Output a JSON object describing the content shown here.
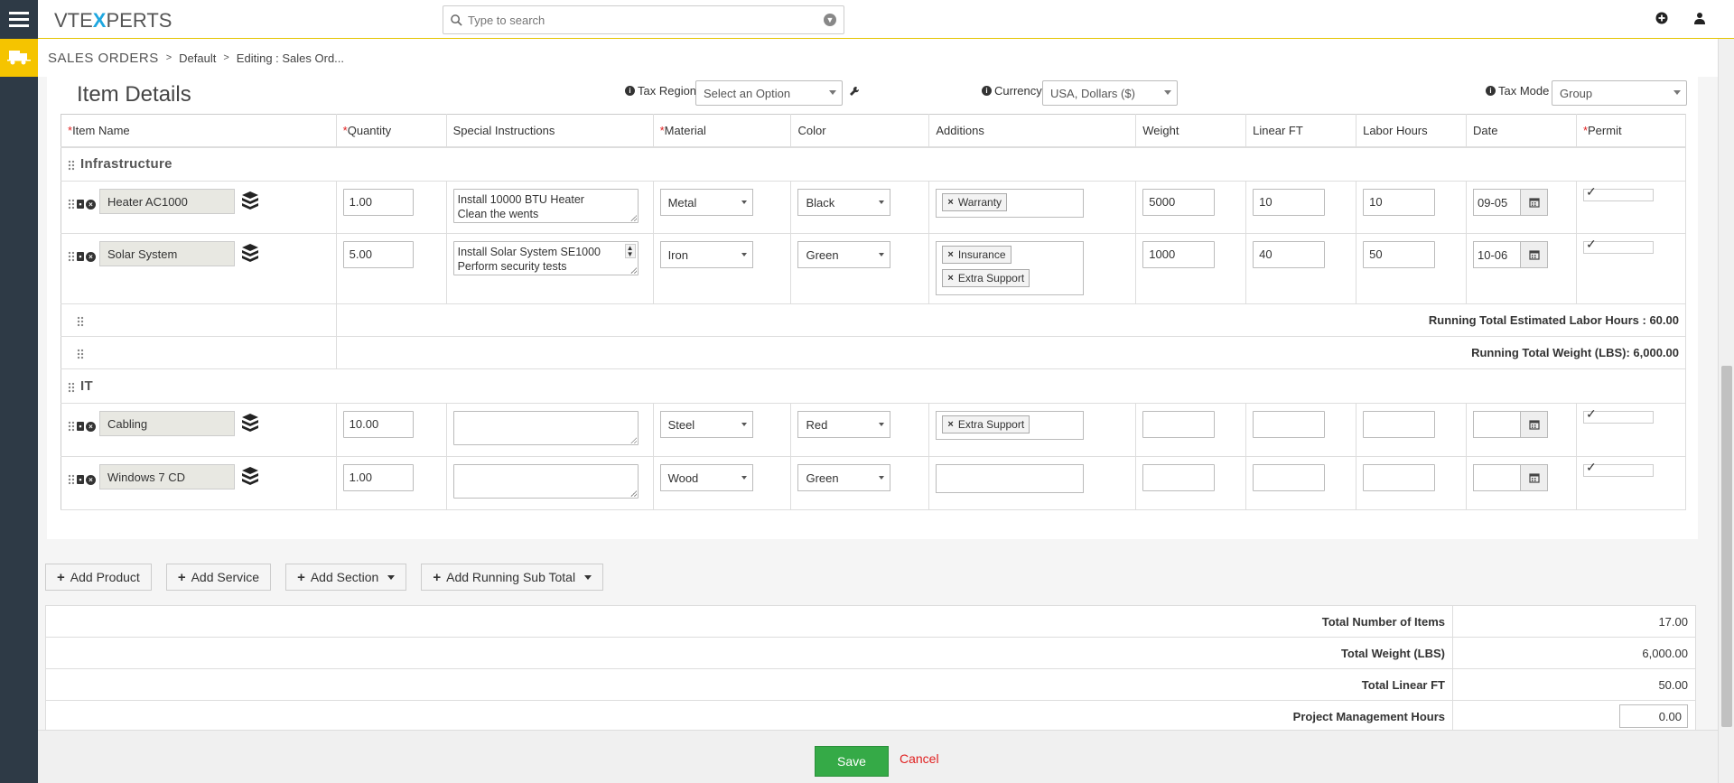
{
  "app": {
    "logo_left": "VTE",
    "logo_x": "X",
    "logo_right": "PERTS"
  },
  "search": {
    "placeholder": "Type to search"
  },
  "breadcrumb": {
    "module": "Sales Orders",
    "items": [
      "Default",
      "Editing : Sales Ord..."
    ]
  },
  "item_details": {
    "title": "Item Details",
    "tax_region_label": "Tax Region",
    "tax_region_value": "Select an Option",
    "currency_label": "Currency",
    "currency_value": "USA, Dollars ($)",
    "tax_mode_label": "Tax Mode",
    "tax_mode_value": "Group"
  },
  "columns": {
    "item_name": "Item Name",
    "quantity": "Quantity",
    "special_instructions": "Special Instructions",
    "material": "Material",
    "color": "Color",
    "additions": "Additions",
    "weight": "Weight",
    "linear_ft": "Linear FT",
    "labor_hours": "Labor Hours",
    "date": "Date",
    "permit": "Permit"
  },
  "sections": [
    {
      "name": "Infrastructure",
      "rows": [
        {
          "name": "Heater AC1000",
          "qty": "1.00",
          "instructions": "Install 10000 BTU Heater\nClean the wents",
          "material": "Metal",
          "color": "Black",
          "additions": [
            "Warranty"
          ],
          "weight": "5000",
          "linear_ft": "10",
          "labor": "10",
          "date": "09-05"
        },
        {
          "name": "Solar System",
          "qty": "5.00",
          "instructions": "Install Solar System SE1000\nPerform security tests",
          "material": "Iron",
          "color": "Green",
          "additions": [
            "Insurance",
            "Extra Support"
          ],
          "weight": "1000",
          "linear_ft": "40",
          "labor": "50",
          "date": "10-06"
        }
      ],
      "running_totals": [
        "Running Total Estimated Labor Hours : 60.00",
        "Running Total Weight (LBS): 6,000.00"
      ]
    },
    {
      "name": "IT",
      "rows": [
        {
          "name": "Cabling",
          "qty": "10.00",
          "instructions": "",
          "material": "Steel",
          "color": "Red",
          "additions": [
            "Extra Support"
          ],
          "weight": "",
          "linear_ft": "",
          "labor": "",
          "date": ""
        },
        {
          "name": "Windows 7 CD",
          "qty": "1.00",
          "instructions": "",
          "material": "Wood",
          "color": "Green",
          "additions": [],
          "weight": "",
          "linear_ft": "",
          "labor": "",
          "date": ""
        }
      ]
    }
  ],
  "buttons": {
    "add_product": "Add Product",
    "add_service": "Add Service",
    "add_section": "Add Section",
    "add_running_sub_total": "Add Running Sub Total"
  },
  "totals": [
    {
      "label": "Total Number of Items",
      "value": "17.00"
    },
    {
      "label": "Total Weight (LBS)",
      "value": "6,000.00"
    },
    {
      "label": "Total Linear FT",
      "value": "50.00"
    },
    {
      "label": "Project Management Hours",
      "value": "0.00"
    }
  ],
  "footer": {
    "save": "Save",
    "cancel": "Cancel"
  },
  "colors": {
    "accent": "#f5c400",
    "save": "#35aa47",
    "cancel": "#e02020",
    "rail": "#2e3a46"
  }
}
